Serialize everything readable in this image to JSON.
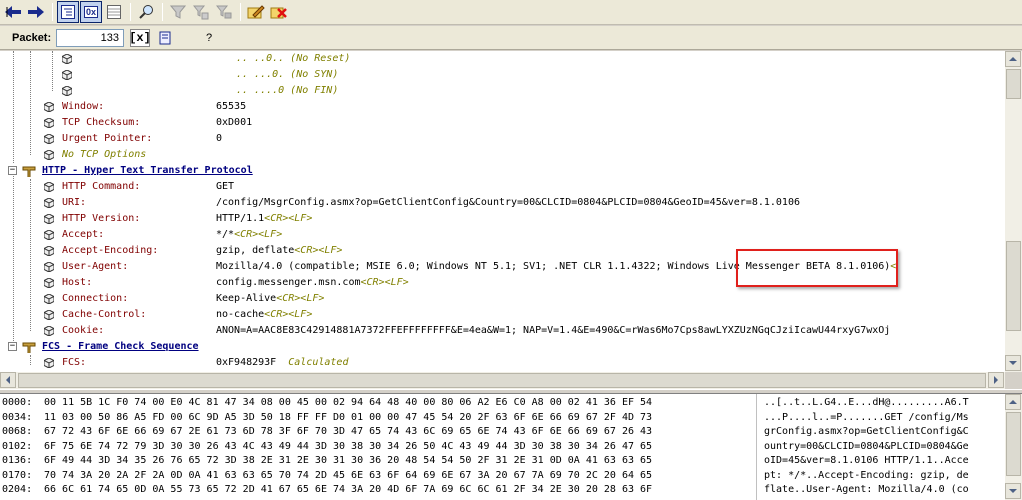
{
  "toolbar": {
    "buttons": [
      {
        "icon": "back-arrow-icon"
      },
      {
        "icon": "forward-arrow-icon"
      },
      {
        "icon": "tree-view-icon"
      },
      {
        "icon": "hex-view-icon",
        "label": "0x"
      },
      {
        "icon": "table-view-icon"
      },
      {
        "icon": "find-icon"
      },
      {
        "icon": "filter-icon"
      },
      {
        "icon": "filter-add-icon"
      },
      {
        "icon": "filter-remove-icon"
      },
      {
        "icon": "edit-icon"
      },
      {
        "icon": "delete-icon"
      }
    ]
  },
  "packetbar": {
    "label": "Packet:",
    "value": "133",
    "bracket_label": "[x]",
    "help_label": "?"
  },
  "tree": {
    "flag_rows": [
      {
        "text": ".. ..0.. (No Reset)"
      },
      {
        "text": ".. ...0. (No SYN)"
      },
      {
        "text": ".. ....0 (No FIN)"
      }
    ],
    "tcp_fields": [
      {
        "name": "Window:",
        "value": "65535"
      },
      {
        "name": "TCP Checksum:",
        "value": "0xD001"
      },
      {
        "name": "Urgent Pointer:",
        "value": "0"
      }
    ],
    "tcp_note": "No TCP Options",
    "http_header": "HTTP - Hyper Text Transfer Protocol",
    "http_fields": [
      {
        "name": "HTTP Command:",
        "value": "GET",
        "crlf": ""
      },
      {
        "name": "URI:",
        "value": "/config/MsgrConfig.asmx?op=GetClientConfig&Country=00&CLCID=0804&PLCID=0804&GeoID=45&ver=8.1.0106",
        "crlf": ""
      },
      {
        "name": "HTTP Version:",
        "value": "HTTP/1.1",
        "crlf": "<CR><LF>"
      },
      {
        "name": "Accept:",
        "value": "*/*",
        "crlf": "<CR><LF>"
      },
      {
        "name": "Accept-Encoding:",
        "value": "gzip, deflate",
        "crlf": "<CR><LF>"
      },
      {
        "name": "User-Agent:",
        "value": "Mozilla/4.0 (compatible; MSIE 6.0; Windows NT 5.1; SV1; .NET CLR 1.1.4322; Windows Live Messenger BETA 8.1.0106)",
        "crlf": "<"
      },
      {
        "name": "Host:",
        "value": "config.messenger.msn.com",
        "crlf": "<CR><LF>"
      },
      {
        "name": "Connection:",
        "value": "Keep-Alive",
        "crlf": "<CR><LF>"
      },
      {
        "name": "Cache-Control:",
        "value": "no-cache",
        "crlf": "<CR><LF>"
      },
      {
        "name": "Cookie:",
        "value": "ANON=A=AAC8E83C42914881A7372FFEFFFFFFFF&E=4ea&W=1; NAP=V=1.4&E=490&C=rWas6Mo7Cps8awLYXZUzNGqCJziIcawU44rxyG7wxOj",
        "crlf": ""
      }
    ],
    "fcs_header": "FCS - Frame Check Sequence",
    "fcs_field": {
      "name": "FCS:",
      "value": "0xF948293F",
      "note": "Calculated"
    }
  },
  "hex": {
    "rows": [
      {
        "offset": "0000:",
        "bytes": "00 11 5B 1C F0 74 00 E0 4C 81 47 34 08 00 45 00 02 94 64 48 40 00 80 06 A2 E6 C0 A8 00 02 41 36 EF 54",
        "ascii": "..[..t..L.G4..E...dH@.........A6.T"
      },
      {
        "offset": "0034:",
        "bytes": "11 03 00 50 86 A5 FD 00 6C 9D A5 3D 50 18 FF FF D0 01 00 00 47 45 54 20 2F 63 6F 6E 66 69 67 2F 4D 73",
        "ascii": "...P....l..=P.......GET /config/Ms"
      },
      {
        "offset": "0068:",
        "bytes": "67 72 43 6F 6E 66 69 67 2E 61 73 6D 78 3F 6F 70 3D 47 65 74 43 6C 69 65 6E 74 43 6F 6E 66 69 67 26 43",
        "ascii": "grConfig.asmx?op=GetClientConfig&C"
      },
      {
        "offset": "0102:",
        "bytes": "6F 75 6E 74 72 79 3D 30 30 26 43 4C 43 49 44 3D 30 38 30 34 26 50 4C 43 49 44 3D 30 38 30 34 26 47 65",
        "ascii": "ountry=00&CLCID=0804&PLCID=0804&Ge"
      },
      {
        "offset": "0136:",
        "bytes": "6F 49 44 3D 34 35 26 76 65 72 3D 38 2E 31 2E 30 31 30 36 20 48 54 54 50 2F 31 2E 31 0D 0A 41 63 63 65",
        "ascii": "oID=45&ver=8.1.0106 HTTP/1.1..Acce"
      },
      {
        "offset": "0170:",
        "bytes": "70 74 3A 20 2A 2F 2A 0D 0A 41 63 63 65 70 74 2D 45 6E 63 6F 64 69 6E 67 3A 20 67 7A 69 70 2C 20 64 65",
        "ascii": "pt: */*..Accept-Encoding: gzip, de"
      },
      {
        "offset": "0204:",
        "bytes": "66 6C 61 74 65 0D 0A 55 73 65 72 2D 41 67 65 6E 74 3A 20 4D 6F 7A 69 6C 6C 61 2F 34 2E 30 20 28 63 6F",
        "ascii": "flate..User-Agent: Mozilla/4.0 (co"
      }
    ]
  },
  "colors": {
    "field_name": "#800000",
    "note": "#808000",
    "protocol": "#000080",
    "highlight_box": "#e0201c"
  }
}
